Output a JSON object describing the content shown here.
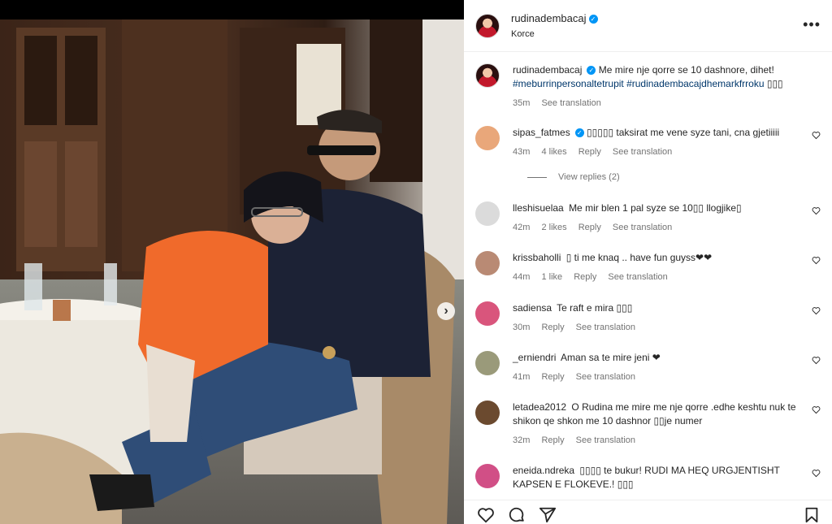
{
  "post": {
    "username": "rudinadembacaj",
    "location": "Korce"
  },
  "caption": {
    "username": "rudinadembacaj",
    "text": "Me mire nje qorre se 10 dashnore, dihet!",
    "hashtags": "#meburrinpersonaltetrupit #rudinadembacajdhemarkfrroku",
    "emoji": "▯▯▯",
    "time": "35m",
    "see_translation": "See translation"
  },
  "comments": [
    {
      "username": "sipas_fatmes",
      "text": "▯▯▯▯▯ taksirat me vene syze tani, cna gjetiiiii",
      "time": "43m",
      "likes": "4 likes",
      "reply": "Reply",
      "see_translation": "See translation",
      "avatar_color": "#e9a77a"
    },
    {
      "username": "lleshisuelaa",
      "text": "Me mir blen 1 pal syze se 10▯▯ llogjike▯",
      "time": "42m",
      "likes": "2 likes",
      "reply": "Reply",
      "see_translation": "See translation",
      "avatar_color": "#dbdbdb"
    },
    {
      "username": "krissbaholli",
      "text": "▯ ti me knaq .. have fun guyss❤❤",
      "time": "44m",
      "likes": "1 like",
      "reply": "Reply",
      "see_translation": "See translation",
      "avatar_color": "#b98a74"
    },
    {
      "username": "sadiensa",
      "text": "Te raft e mira ▯▯▯",
      "time": "30m",
      "reply": "Reply",
      "see_translation": "See translation",
      "avatar_color": "#d9557c"
    },
    {
      "username": "_erniendri",
      "text": "Aman sa te mire jeni ❤",
      "time": "41m",
      "reply": "Reply",
      "see_translation": "See translation",
      "avatar_color": "#9a9a7a"
    },
    {
      "username": "letadea2012",
      "text": "O Rudina me mire me nje qorre .edhe keshtu nuk te shikon qe shkon me 10 dashnor ▯▯je numer",
      "time": "32m",
      "reply": "Reply",
      "see_translation": "See translation",
      "avatar_color": "#6b4a2f"
    },
    {
      "username": "eneida.ndreka",
      "text": "▯▯▯▯ te bukur! RUDI MA HEQ URGJENTISHT KAPSEN E FLOKEVE.! ▯▯▯",
      "time": "",
      "avatar_color": "#d14f86"
    }
  ],
  "view_replies": "View replies (2)",
  "icons": {
    "like": "heart-icon",
    "comment": "comment-icon",
    "share": "share-icon",
    "save": "bookmark-icon",
    "more": "more-options-icon",
    "next": "chevron-right-icon"
  },
  "colors": {
    "verified": "#0095f6",
    "hashtag": "#00376b",
    "meta": "#737373"
  }
}
